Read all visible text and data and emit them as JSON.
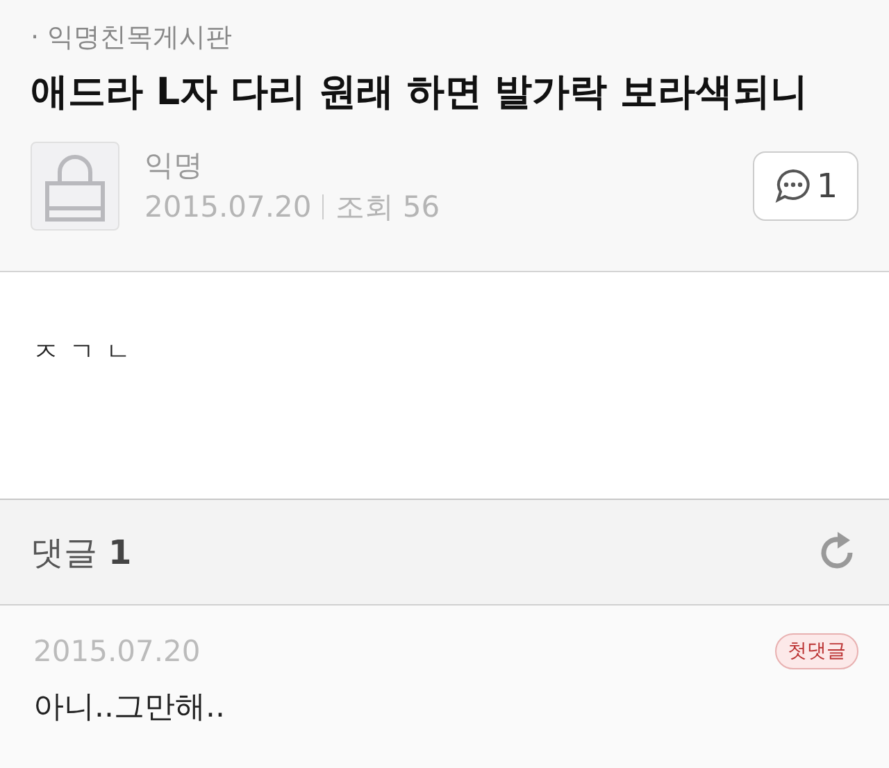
{
  "board": "· 익명친목게시판",
  "title": "애드라 L자 다리 원래 하면 발가락 보라색되니",
  "author": {
    "name": "익명",
    "date": "2015.07.20",
    "views": "조회 56"
  },
  "comment_button": {
    "count": "1"
  },
  "body": "ㅈㄱㄴ",
  "comments_header": {
    "label": "댓글",
    "count": "1"
  },
  "comments": [
    {
      "date": "2015.07.20",
      "badge": "첫댓글",
      "text": "아니..그만해.."
    }
  ]
}
